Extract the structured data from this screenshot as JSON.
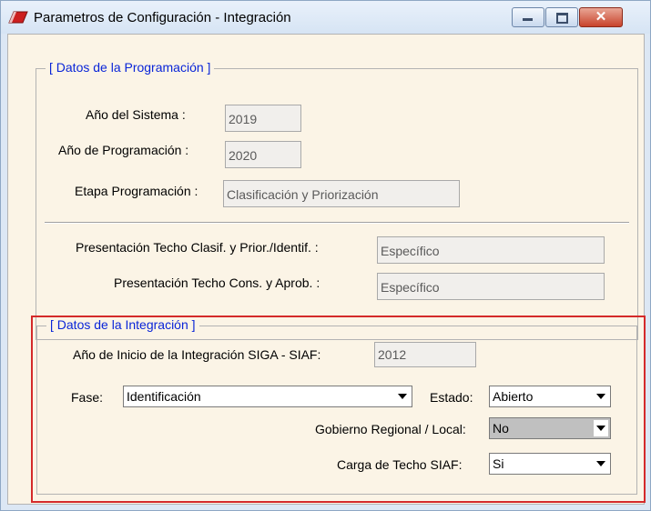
{
  "window": {
    "title": "Parametros de Configuración - Integración"
  },
  "programacion": {
    "legend": "[ Datos de la Programación ]",
    "anio_sistema": {
      "label": "Año del Sistema :",
      "value": "2019"
    },
    "anio_programacion": {
      "label": "Año de Programación :",
      "value": "2020"
    },
    "etapa": {
      "label": "Etapa Programación :",
      "value": "Clasificación y Priorización"
    },
    "techo_clasif": {
      "label": "Presentación Techo Clasif. y Prior./Identif. :",
      "value": "Específico"
    },
    "techo_cons": {
      "label": "Presentación Techo Cons. y Aprob. :",
      "value": "Específico"
    }
  },
  "integracion": {
    "legend": "[ Datos de la Integración ]",
    "anio_inicio": {
      "label": "Año de Inicio de la Integración SIGA - SIAF:",
      "value": "2012"
    },
    "fase": {
      "label": "Fase:",
      "value": "Identificación"
    },
    "estado": {
      "label": "Estado:",
      "value": "Abierto"
    },
    "gobierno": {
      "label": "Gobierno Regional / Local:",
      "value": "No"
    },
    "carga": {
      "label": "Carga de Techo SIAF:",
      "value": "Si"
    }
  },
  "colors": {
    "legend_text": "#0a25d8",
    "highlight_border": "#d42a2a",
    "client_bg": "#fbf4e6"
  }
}
